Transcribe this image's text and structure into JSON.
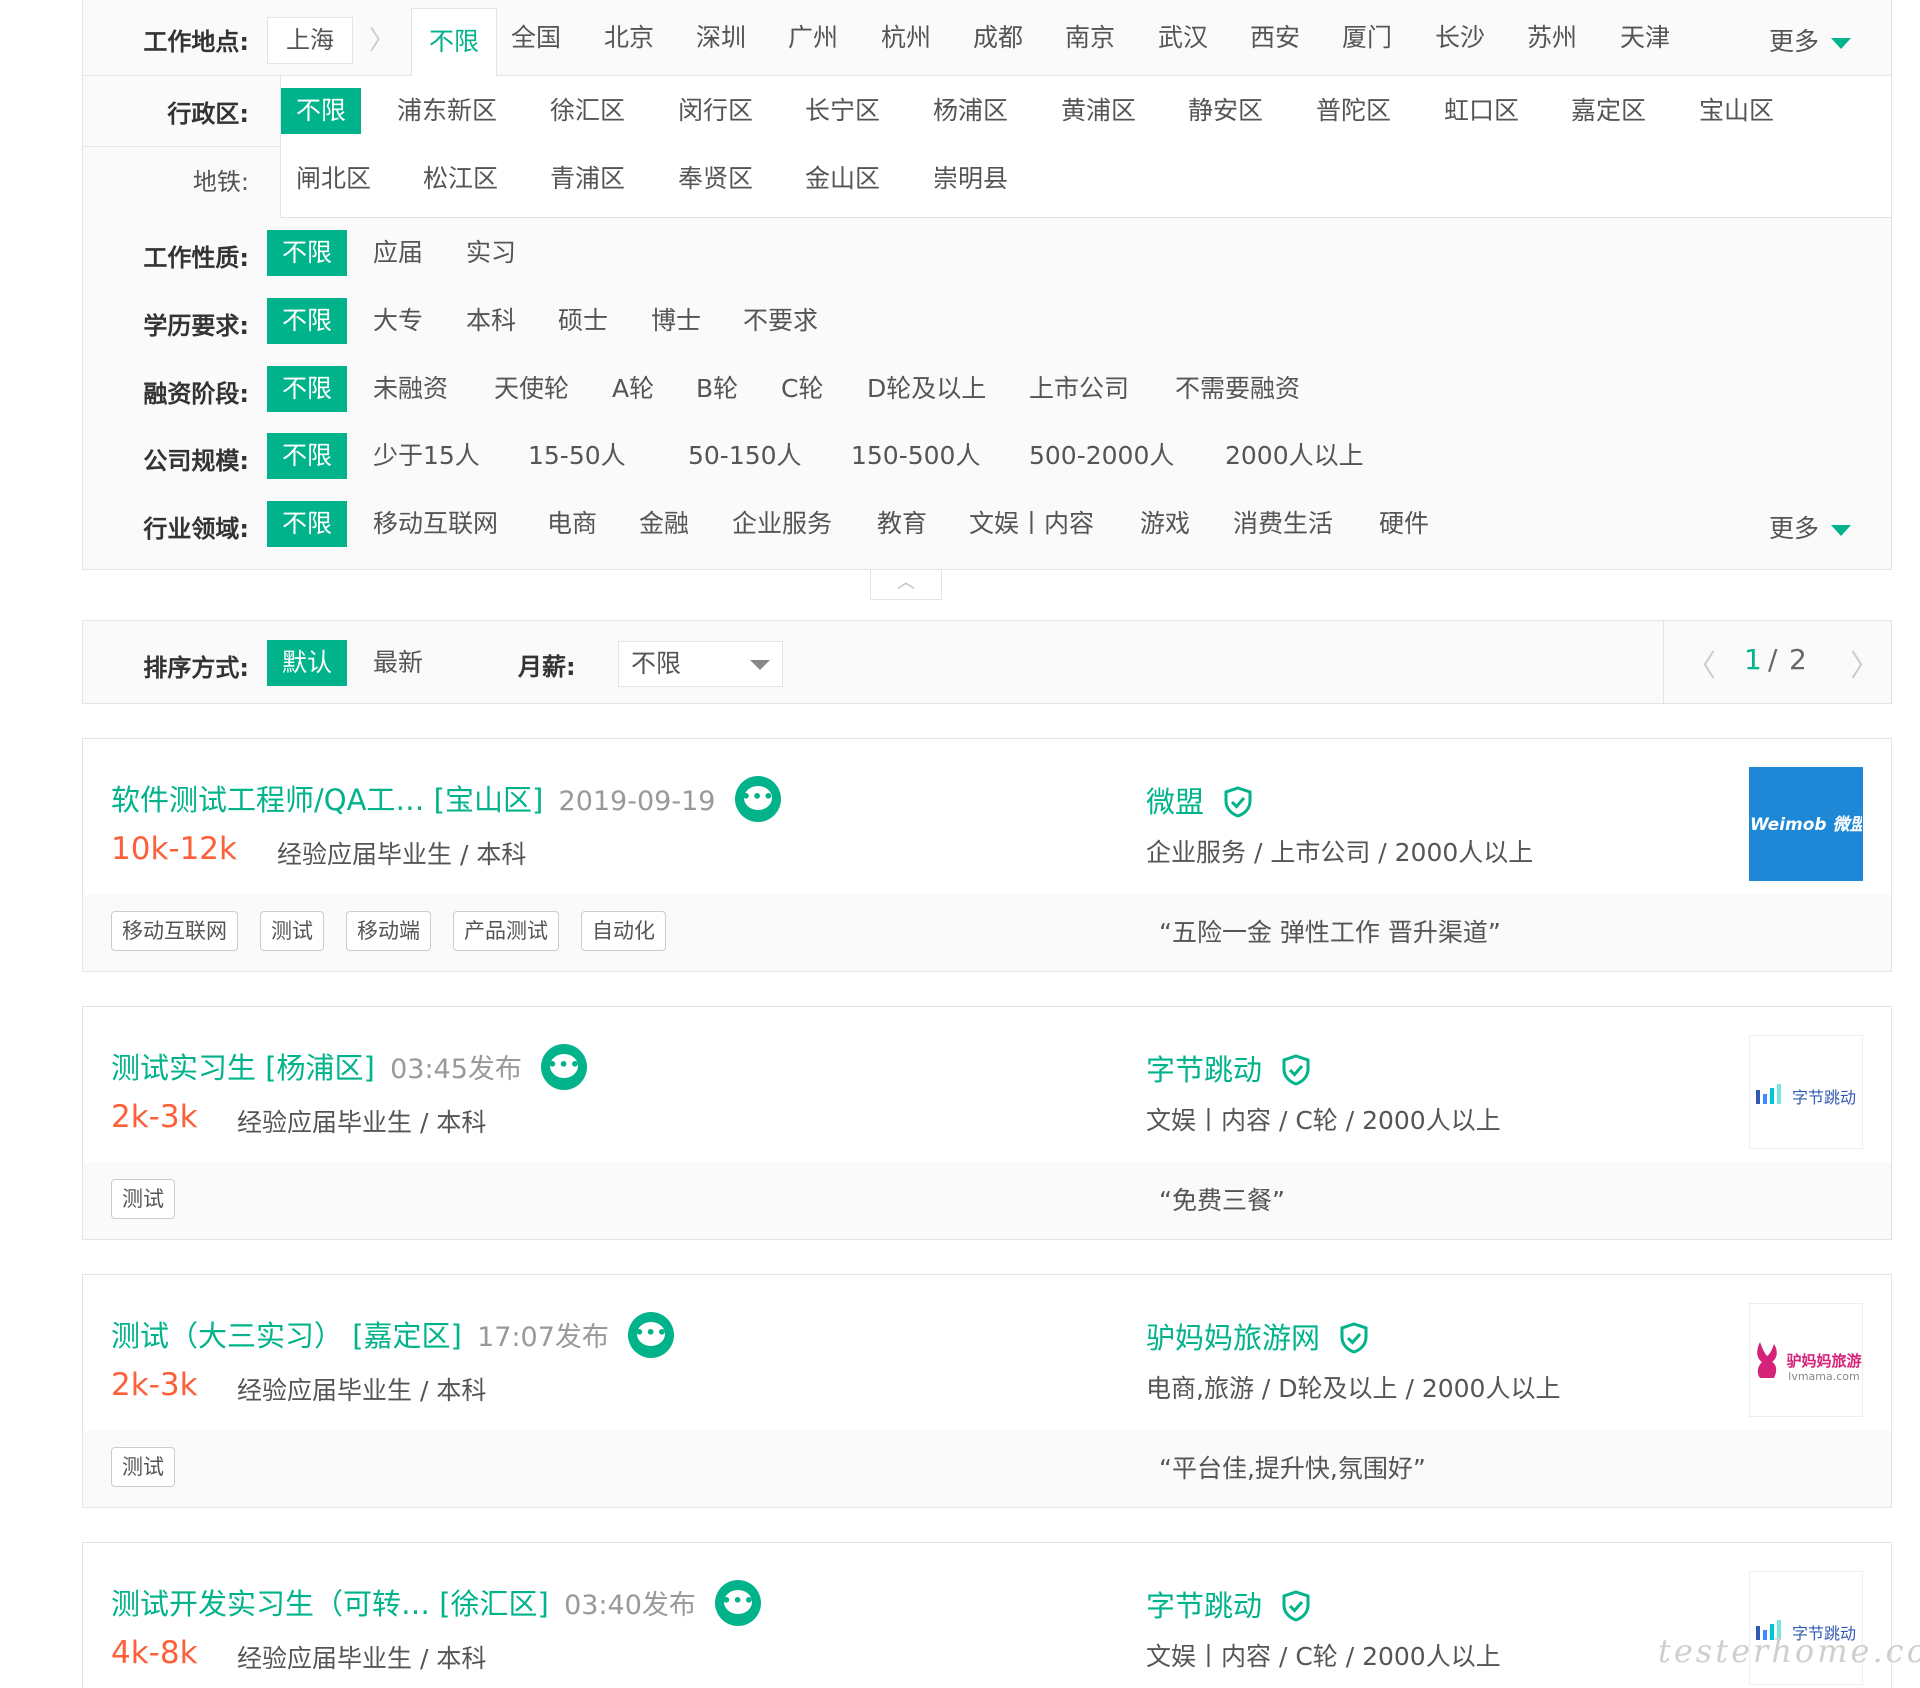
{
  "colors": {
    "accent": "#00b38a",
    "salary": "#fd5f39",
    "border": "#e4e4e4",
    "panel_bg": "#fafafa"
  },
  "location": {
    "label": "工作地点:",
    "current_city": "上海",
    "unlimited": "不限",
    "cities": [
      "全国",
      "北京",
      "深圳",
      "广州",
      "杭州",
      "成都",
      "南京",
      "武汉",
      "西安",
      "厦门",
      "长沙",
      "苏州",
      "天津"
    ],
    "more": "更多"
  },
  "district": {
    "label": "行政区:",
    "subway_label": "地铁:",
    "unlimited": "不限",
    "row1": [
      "浦东新区",
      "徐汇区",
      "闵行区",
      "长宁区",
      "杨浦区",
      "黄浦区",
      "静安区",
      "普陀区",
      "虹口区",
      "嘉定区",
      "宝山区"
    ],
    "row2": [
      "闸北区",
      "松江区",
      "青浦区",
      "奉贤区",
      "金山区",
      "崇明县"
    ]
  },
  "nature": {
    "label": "工作性质:",
    "active": "不限",
    "options": [
      "应届",
      "实习"
    ]
  },
  "education": {
    "label": "学历要求:",
    "active": "不限",
    "options": [
      "大专",
      "本科",
      "硕士",
      "博士",
      "不要求"
    ]
  },
  "funding": {
    "label": "融资阶段:",
    "active": "不限",
    "options": [
      "未融资",
      "天使轮",
      "A轮",
      "B轮",
      "C轮",
      "D轮及以上",
      "上市公司",
      "不需要融资"
    ]
  },
  "size": {
    "label": "公司规模:",
    "active": "不限",
    "options": [
      "少于15人",
      "15-50人",
      "50-150人",
      "150-500人",
      "500-2000人",
      "2000人以上"
    ]
  },
  "industry": {
    "label": "行业领域:",
    "active": "不限",
    "options": [
      "移动互联网",
      "电商",
      "金融",
      "企业服务",
      "教育",
      "文娱丨内容",
      "游戏",
      "消费生活",
      "硬件"
    ],
    "more": "更多"
  },
  "collapse_icon": "chevron-up-icon",
  "sort": {
    "label": "排序方式:",
    "active": "默认",
    "other": "最新",
    "salary_label": "月薪:",
    "salary_value": "不限",
    "page_current": "1",
    "page_sep": "/",
    "page_total": "2"
  },
  "jobs": [
    {
      "title": "软件测试工程师/QA工…",
      "district": "[宝山区]",
      "time": "2019-09-19",
      "salary": "10k-12k",
      "requirement": "经验应届毕业生 / 本科",
      "company": "微盟",
      "company_info": "企业服务 / 上市公司 / 2000人以上",
      "logo_text": "Weimob 微盟",
      "tags": [
        "移动互联网",
        "测试",
        "移动端",
        "产品测试",
        "自动化"
      ],
      "benefit": "“五险一金 弹性工作 晋升渠道”"
    },
    {
      "title": "测试实习生",
      "district": "[杨浦区]",
      "time": "03:45发布",
      "salary": "2k-3k",
      "requirement": "经验应届毕业生 / 本科",
      "company": "字节跳动",
      "company_info": "文娱丨内容 / C轮 / 2000人以上",
      "logo_text": "字节跳动",
      "tags": [
        "测试"
      ],
      "benefit": "“免费三餐”"
    },
    {
      "title": "测试（大三实习）",
      "district": "[嘉定区]",
      "time": "17:07发布",
      "salary": "2k-3k",
      "requirement": "经验应届毕业生 / 本科",
      "company": "驴妈妈旅游网",
      "company_info": "电商,旅游 / D轮及以上 / 2000人以上",
      "logo_text": "驴妈妈旅游",
      "logo_sub": "lvmama.com",
      "tags": [
        "测试"
      ],
      "benefit": "“平台佳,提升快,氛围好”"
    },
    {
      "title": "测试开发实习生（可转…",
      "district": "[徐汇区]",
      "time": "03:40发布",
      "salary": "4k-8k",
      "requirement": "经验应届毕业生 / 本科",
      "company": "字节跳动",
      "company_info": "文娱丨内容 / C轮 / 2000人以上",
      "logo_text": "字节跳动"
    }
  ],
  "watermark": "testerhome.com"
}
